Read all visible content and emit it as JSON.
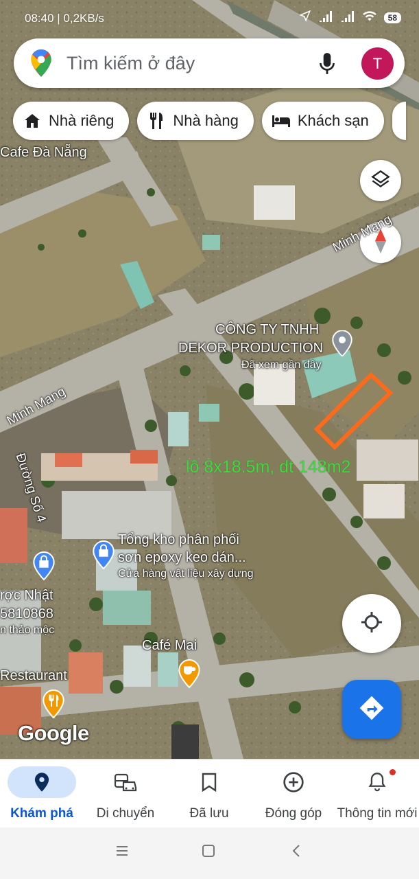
{
  "status_bar": {
    "time": "08:40 | 0,2KB/s",
    "battery": "58"
  },
  "search": {
    "placeholder": "Tìm kiếm ở đây",
    "avatar_letter": "T"
  },
  "chips": [
    {
      "label": "Nhà riêng",
      "icon": "home-icon"
    },
    {
      "label": "Nhà hàng",
      "icon": "restaurant-icon"
    },
    {
      "label": "Khách sạn",
      "icon": "hotel-icon"
    }
  ],
  "map": {
    "labels": {
      "cafe_da_nang": "Cafe Đà Nẵng",
      "street_minh_mang_top": "Minh Mạng",
      "street_minh_mang_left": "Minh Mạng",
      "street_duong_so_4": "Đường Số 4",
      "company_line1": "CÔNG TY TNHH",
      "company_line2": "DEKOR PRODUCTION",
      "company_sub": "Đã xem gần đây",
      "annotation": "lô 8x18.5m, dt 148m2",
      "tong_kho_line1": "Tổng kho phân phối",
      "tong_kho_line2": "sơn epoxy keo dán...",
      "tong_kho_sub": "Cửa hàng vật liệu xây dựng",
      "left_poi_line1": "rợc Nhật",
      "left_poi_line2": "5810868",
      "left_poi_line3": "n thảo mộc",
      "cafe_mai": "Café Mai",
      "restaurant": "Restaurant",
      "google": "Google"
    }
  },
  "bottom_nav": [
    {
      "label": "Khám phá",
      "icon": "explore-pin-icon",
      "active": true
    },
    {
      "label": "Di chuyển",
      "icon": "commute-icon",
      "active": false
    },
    {
      "label": "Đã lưu",
      "icon": "bookmark-icon",
      "active": false
    },
    {
      "label": "Đóng góp",
      "icon": "add-circle-icon",
      "active": false
    },
    {
      "label": "Thông tin mới",
      "icon": "bell-icon",
      "active": false
    }
  ],
  "colors": {
    "accent_blue": "#1a73e8",
    "annotation_green": "#3ddc3d",
    "plot_outline": "#ff6a1a",
    "avatar": "#c2185b"
  }
}
